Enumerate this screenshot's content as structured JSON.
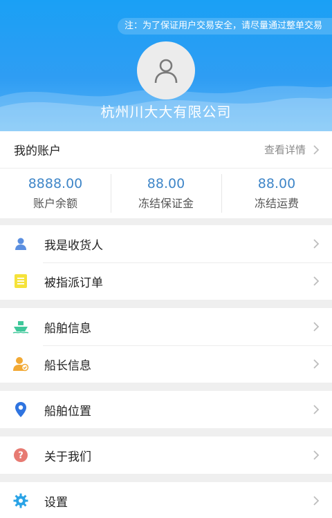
{
  "header": {
    "notice": "注：为了保证用户交易安全，请尽量通过整单交易",
    "company_name": "杭州川大大有限公司"
  },
  "account": {
    "title": "我的账户",
    "detail_link": "查看详情",
    "stats": [
      {
        "value": "8888.00",
        "label": "账户余额"
      },
      {
        "value": "88.00",
        "label": "冻结保证金"
      },
      {
        "value": "88.00",
        "label": "冻结运费"
      }
    ]
  },
  "menu": {
    "receiver": "我是收货人",
    "assigned_orders": "被指派订单",
    "ship_info": "船舶信息",
    "captain_info": "船长信息",
    "ship_location": "船舶位置",
    "about_us": "关于我们",
    "settings": "设置"
  },
  "icons": {
    "receiver": "person-icon",
    "assigned_orders": "document-icon",
    "ship_info": "ship-icon",
    "captain_info": "captain-icon",
    "ship_location": "location-pin-icon",
    "about_us": "question-icon",
    "settings": "gear-icon"
  },
  "colors": {
    "header": "#2f9df3",
    "stat_value": "#3f86c8",
    "person_icon": "#5b8fe0",
    "document_icon": "#f5e23a",
    "ship_icon": "#3fc79a",
    "captain_icon": "#f2a934",
    "location_icon": "#2f74e0",
    "question_icon": "#e77a72",
    "gear_icon": "#2aa3e6"
  }
}
